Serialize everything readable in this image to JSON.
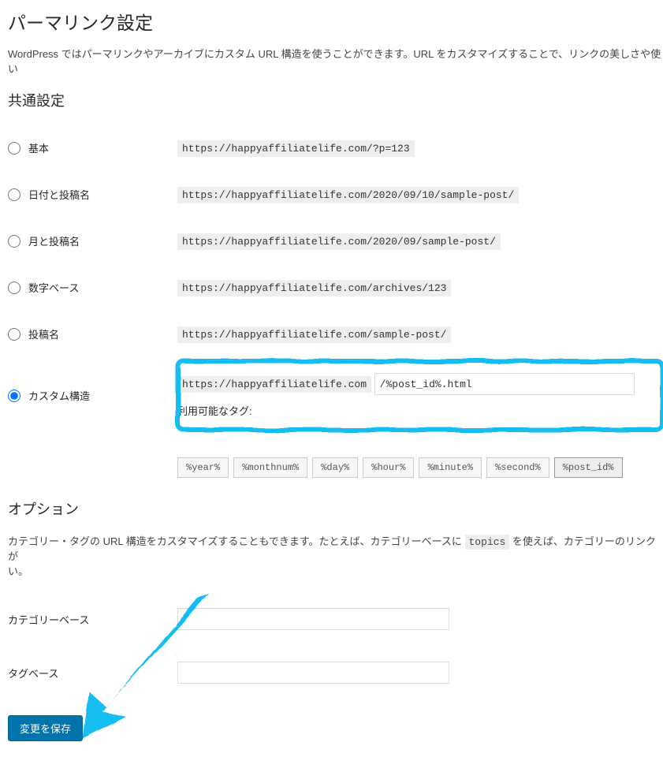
{
  "page_title": "パーマリンク設定",
  "intro": "WordPress ではパーマリンクやアーカイブにカスタム URL 構造を使うことができます。URL をカスタマイズすることで、リンクの美しさや使い",
  "common_settings_heading": "共通設定",
  "options": {
    "plain": {
      "label": "基本",
      "example": "https://happyaffiliatelife.com/?p=123"
    },
    "day_name": {
      "label": "日付と投稿名",
      "example": "https://happyaffiliatelife.com/2020/09/10/sample-post/"
    },
    "month_name": {
      "label": "月と投稿名",
      "example": "https://happyaffiliatelife.com/2020/09/sample-post/"
    },
    "numeric": {
      "label": "数字ベース",
      "example": "https://happyaffiliatelife.com/archives/123"
    },
    "post_name": {
      "label": "投稿名",
      "example": "https://happyaffiliatelife.com/sample-post/"
    },
    "custom": {
      "label": "カスタム構造",
      "base": "https://happyaffiliatelife.com",
      "value": "/%post_id%.html",
      "available_label": "利用可能なタグ:"
    }
  },
  "tags": [
    "%year%",
    "%monthnum%",
    "%day%",
    "%hour%",
    "%minute%",
    "%second%",
    "%post_id%"
  ],
  "active_tag": "%post_id%",
  "options_section": {
    "heading": "オプション",
    "desc_pre": "カテゴリー・タグの URL 構造をカスタマイズすることもできます。たとえば、カテゴリーベースに ",
    "desc_code": "topics",
    "desc_post": " を使えば、カテゴリーのリンクが",
    "desc_tail": "い。",
    "category_base_label": "カテゴリーベース",
    "tag_base_label": "タグベース"
  },
  "submit_label": "変更を保存"
}
